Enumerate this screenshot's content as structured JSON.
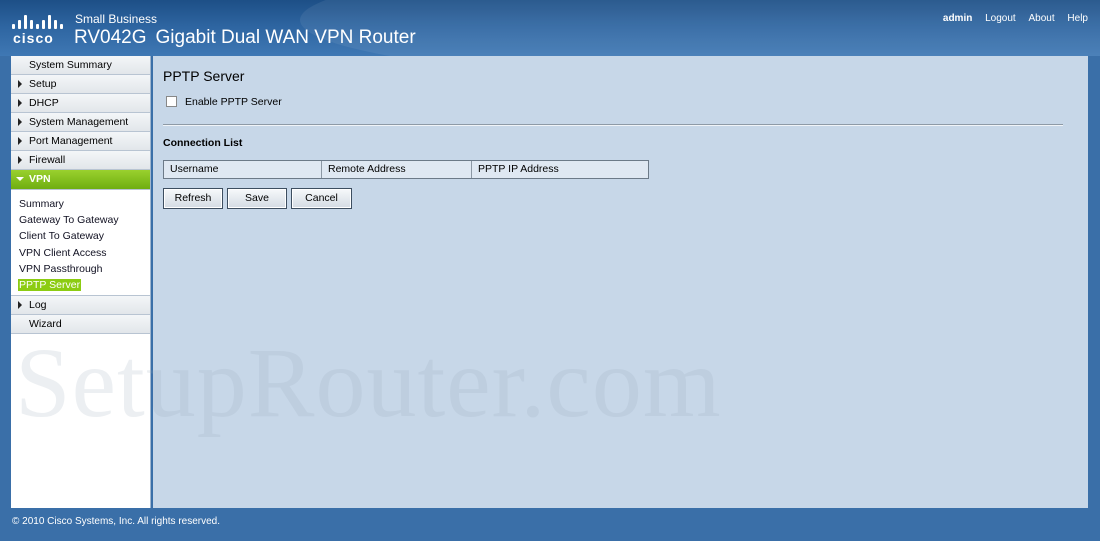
{
  "header": {
    "logo_text": "cisco",
    "brand_small": "Small Business",
    "model": "RV042G",
    "product": "Gigabit Dual WAN VPN Router",
    "links": {
      "user": "admin",
      "logout": "Logout",
      "about": "About",
      "help": "Help"
    }
  },
  "sidebar": {
    "items": [
      {
        "label": "System Summary"
      },
      {
        "label": "Setup"
      },
      {
        "label": "DHCP"
      },
      {
        "label": "System Management"
      },
      {
        "label": "Port Management"
      },
      {
        "label": "Firewall"
      },
      {
        "label": "VPN"
      },
      {
        "label": "Log"
      },
      {
        "label": "Wizard"
      }
    ],
    "vpn_sub": [
      {
        "label": "Summary"
      },
      {
        "label": "Gateway To Gateway"
      },
      {
        "label": "Client To Gateway"
      },
      {
        "label": "VPN Client Access"
      },
      {
        "label": "VPN Passthrough"
      },
      {
        "label": "PPTP Server"
      }
    ]
  },
  "main": {
    "title": "PPTP Server",
    "enable_label": "Enable PPTP Server",
    "enable_checked": false,
    "connection_list_label": "Connection List",
    "table_headers": [
      "Username",
      "Remote Address",
      "PPTP IP Address"
    ],
    "buttons": {
      "refresh": "Refresh",
      "save": "Save",
      "cancel": "Cancel"
    }
  },
  "watermark": "SetupRouter.com",
  "footer": "© 2010 Cisco Systems, Inc. All rights reserved.",
  "colors": {
    "accent_green": "#8ccc12",
    "header_blue": "#2d64a0",
    "content_bg": "#c7d7e8"
  }
}
